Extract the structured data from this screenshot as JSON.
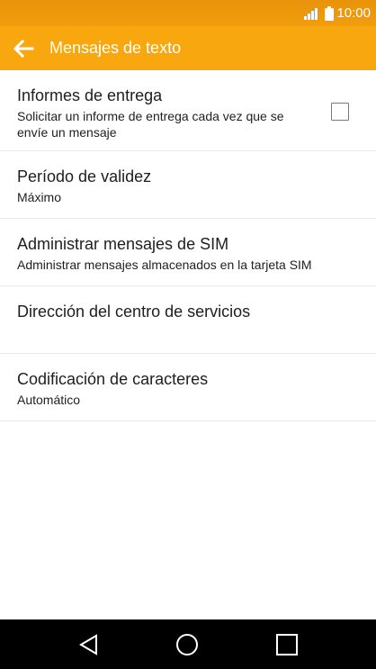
{
  "status_bar": {
    "time": "10:00",
    "icons": [
      "signal-icon",
      "battery-icon"
    ]
  },
  "app_bar": {
    "title": "Mensajes de texto",
    "back_icon": "arrow-left-icon"
  },
  "settings": [
    {
      "title": "Informes de entrega",
      "summary": "Solicitar un informe de entrega cada vez que se envíe un mensaje",
      "checkbox_checked": false
    },
    {
      "title": "Período de validez",
      "summary": "Máximo"
    },
    {
      "title": "Administrar mensajes de SIM",
      "summary": "Administrar mensajes almacenados en la tarjeta SIM"
    },
    {
      "title": "Dirección del centro de servicios",
      "summary": ""
    },
    {
      "title": "Codificación de caracteres",
      "summary": "Automático"
    }
  ],
  "nav_bar": {
    "icons": [
      "back-triangle-icon",
      "home-circle-icon",
      "recents-square-icon"
    ]
  },
  "colors": {
    "status_bar": "#f19d0c",
    "app_bar": "#f9a70e",
    "text": "#1e1e1e",
    "divider": "#e9e9e9",
    "nav_bar": "#000000"
  }
}
